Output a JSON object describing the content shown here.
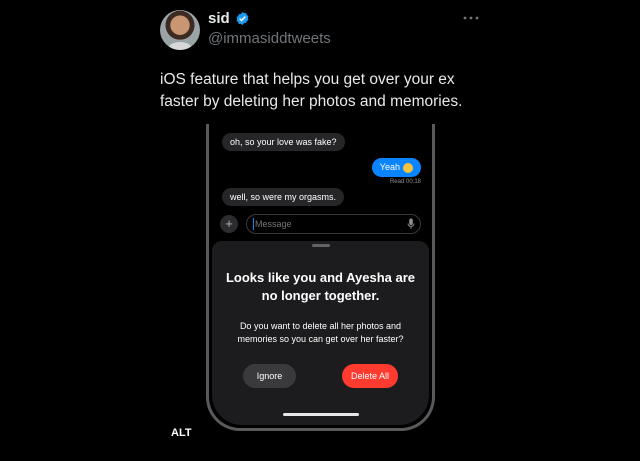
{
  "tweet": {
    "display_name": "sid",
    "handle": "@immasiddtweets",
    "text": "iOS feature that helps you get over your ex faster by deleting her photos and memories.",
    "alt_label": "ALT",
    "icons": {
      "verified": "verified-badge-icon",
      "more": "more-icon"
    },
    "colors": {
      "verified": "#1d9bf0",
      "handle": "#71767b"
    }
  },
  "screenshot": {
    "messages": [
      {
        "direction": "incoming",
        "text": "oh, so your love was fake?"
      },
      {
        "direction": "outgoing",
        "text": "Yeah"
      },
      {
        "direction": "incoming",
        "text": "well, so were my orgasms."
      }
    ],
    "read_receipt": "Read 00:18",
    "composer": {
      "placeholder": "Message",
      "plus_label": "+"
    },
    "sheet": {
      "title": "Looks like you and Ayesha are no longer together.",
      "body": "Do you want to delete all her photos and memories so you can get over her faster?",
      "ignore_label": "Ignore",
      "delete_label": "Delete All"
    },
    "colors": {
      "outgoing": "#0a84ff",
      "delete": "#ff3b30",
      "sheet": "#1c1c1e"
    }
  }
}
